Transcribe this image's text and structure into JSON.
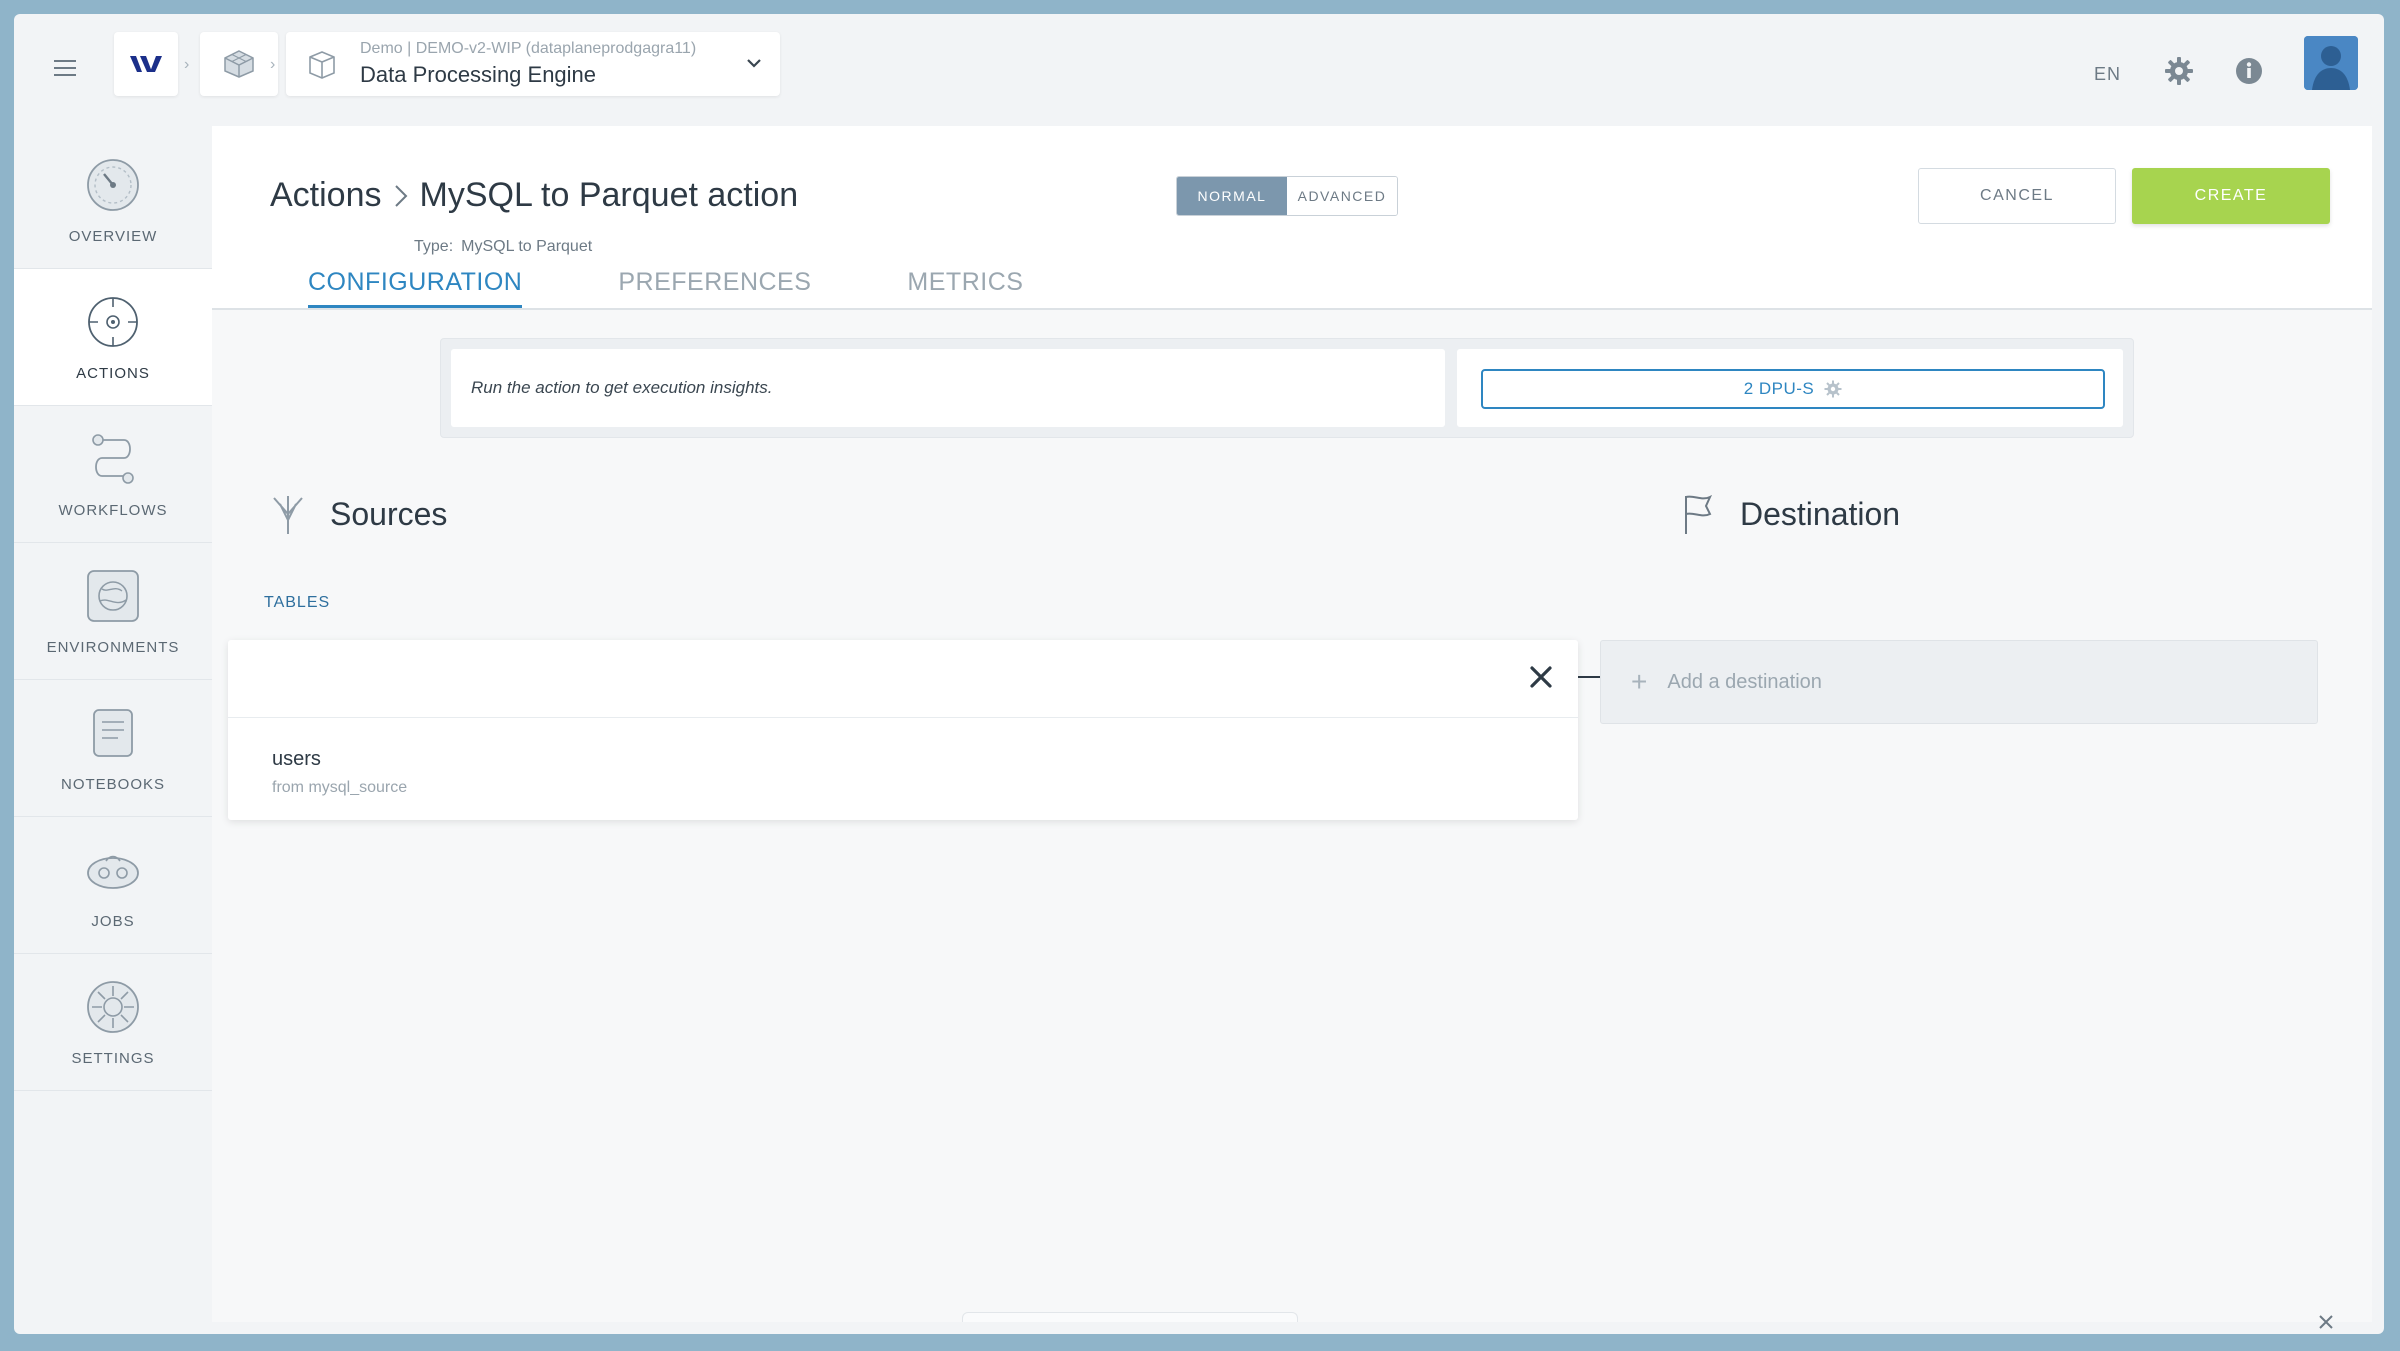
{
  "topbar": {
    "engine_meta": "Demo | DEMO-v2-WIP (dataplaneprodgagra11)",
    "engine_name": "Data Processing Engine",
    "language": "EN"
  },
  "sidebar": {
    "items": [
      {
        "label": "OVERVIEW",
        "icon": "gauge-icon",
        "active": false
      },
      {
        "label": "ACTIONS",
        "icon": "target-icon",
        "active": true
      },
      {
        "label": "WORKFLOWS",
        "icon": "workflow-icon",
        "active": false
      },
      {
        "label": "ENVIRONMENTS",
        "icon": "environment-icon",
        "active": false
      },
      {
        "label": "NOTEBOOKS",
        "icon": "notebook-icon",
        "active": false
      },
      {
        "label": "JOBS",
        "icon": "jobs-icon",
        "active": false
      },
      {
        "label": "SETTINGS",
        "icon": "settings-icon",
        "active": false
      }
    ]
  },
  "header": {
    "breadcrumb_parent": "Actions",
    "title": "MySQL to Parquet action",
    "type_label": "Type:",
    "type_value": "MySQL to Parquet",
    "mode_normal": "NORMAL",
    "mode_advanced": "ADVANCED",
    "cancel_label": "CANCEL",
    "create_label": "CREATE"
  },
  "tabs": [
    {
      "label": "CONFIGURATION",
      "active": true
    },
    {
      "label": "PREFERENCES",
      "active": false
    },
    {
      "label": "METRICS",
      "active": false
    }
  ],
  "insights": {
    "message": "Run the action to get execution insights.",
    "dpu_label": "2 DPU-S"
  },
  "sources": {
    "title": "Sources",
    "tables_label": "TABLES",
    "items": [
      {
        "name": "users",
        "from": "from mysql_source"
      }
    ]
  },
  "destination": {
    "title": "Destination",
    "add_label": "Add a destination"
  },
  "colors": {
    "accent": "#2e86c1",
    "create": "#a7d44f",
    "mode_active": "#7c97ad"
  }
}
